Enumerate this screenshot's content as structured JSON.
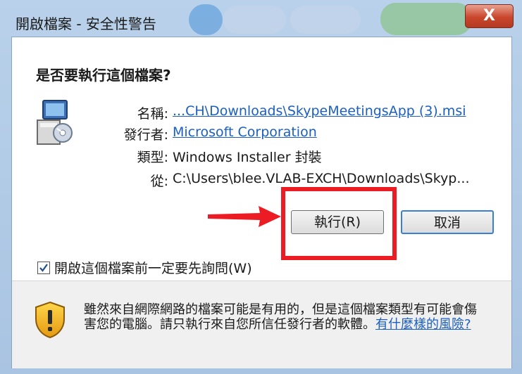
{
  "window": {
    "title": "開啟檔案 - 安全性警告",
    "close_label": "X"
  },
  "dialog": {
    "question": "是否要執行這個檔案?",
    "fields": [
      {
        "label": "名稱:",
        "value": "...CH\\Downloads\\SkypeMeetingsApp (3).msi"
      },
      {
        "label": "發行者:",
        "value": "Microsoft Corporation"
      },
      {
        "label": "類型:",
        "value": "Windows Installer 封裝"
      },
      {
        "label": "從:",
        "value": "C:\\Users\\blee.VLAB-EXCH\\Downloads\\Skyp..."
      }
    ],
    "run_button": "執行(R)",
    "cancel_button": "取消",
    "checkbox_label": "開啟這個檔案前一定要先詢問(W)",
    "checkbox_checked": true,
    "warning_text": "雖然來自網際網路的檔案可能是有用的，但是這個檔案類型有可能會傷害您的電腦。請只執行來自您所信任發行者的軟體。",
    "warning_link": "有什麼樣的風險?"
  },
  "colors": {
    "link": "#1c5fbf",
    "highlight_box": "#ec1c24",
    "arrow": "#ec1c24",
    "close_button": "#c9462c",
    "cancel_focus_border": "#3c7fd2"
  },
  "icons": {
    "app": "installer-package-icon",
    "warning": "security-shield-icon",
    "annotation": "red-arrow-icon"
  }
}
